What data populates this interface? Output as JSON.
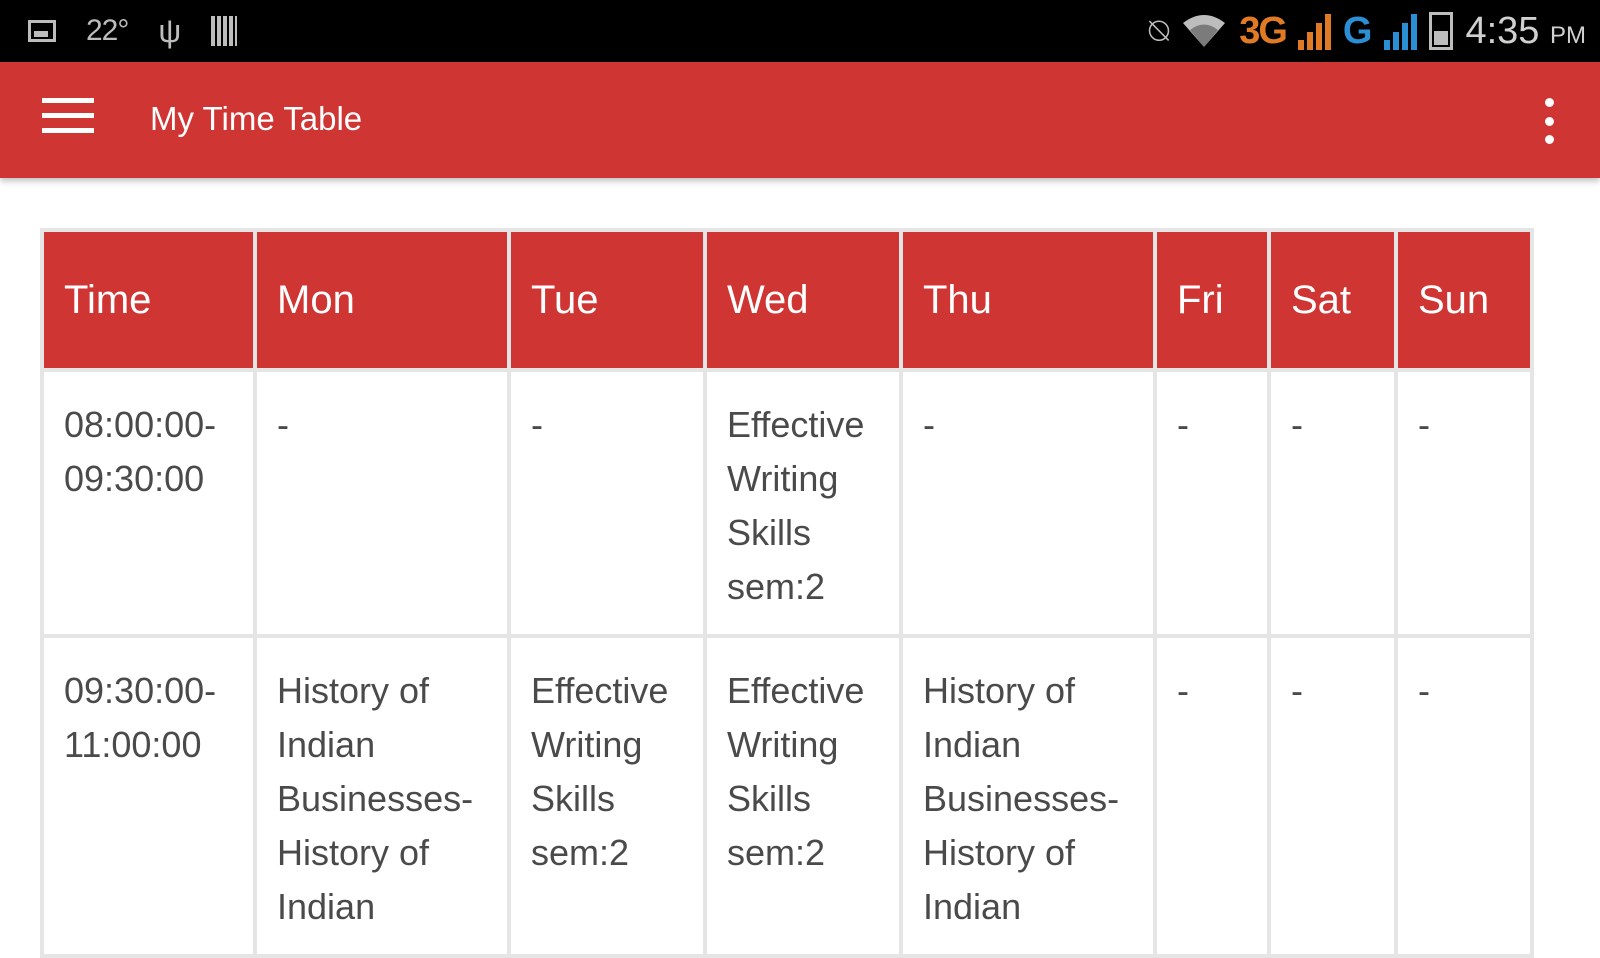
{
  "status_bar": {
    "temperature": "22°",
    "network_3g": "3G",
    "network_g": "G",
    "time": "4:35",
    "ampm": "PM",
    "icons": [
      "image-icon",
      "usb-icon",
      "sd-card-icon",
      "mute-icon",
      "wifi-icon",
      "signal-icon",
      "battery-icon"
    ]
  },
  "appbar": {
    "title": "My Time Table",
    "color": "#cf3533"
  },
  "timetable": {
    "headers": [
      "Time",
      "Mon",
      "Tue",
      "Wed",
      "Thu",
      "Fri",
      "Sat",
      "Sun"
    ],
    "rows": [
      {
        "time": "08:00:00-09:30:00",
        "cells": [
          "-",
          "-",
          "Effective Writing Skills sem:2",
          "-",
          "-",
          "-",
          "-"
        ]
      },
      {
        "time": "09:30:00-11:00:00",
        "cells": [
          "History of Indian Businesses-History of Indian",
          "Effective Writing Skills sem:2",
          "Effective Writing Skills sem:2",
          "History of Indian Businesses-History of Indian",
          "-",
          "-",
          "-"
        ]
      }
    ]
  }
}
